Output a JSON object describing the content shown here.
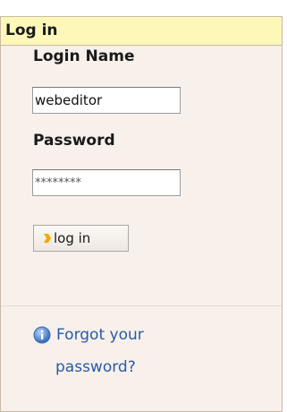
{
  "portlet": {
    "title": "Log in"
  },
  "login_form": {
    "login_name_label": "Login Name",
    "login_name_value": "webeditor",
    "password_label": "Password",
    "password_value": "********",
    "submit_label": "log in"
  },
  "links": {
    "forgot_line1": "Forgot your",
    "forgot_line2": "password?"
  },
  "icons": {
    "button_icon": "arrow-icon",
    "link_icon": "info-icon"
  },
  "colors": {
    "header_bg": "#fef8b8",
    "panel_bg": "#f7f0eb",
    "border": "#c9b9a3",
    "link": "#2a5aa8",
    "arrow": "#f5a800"
  }
}
